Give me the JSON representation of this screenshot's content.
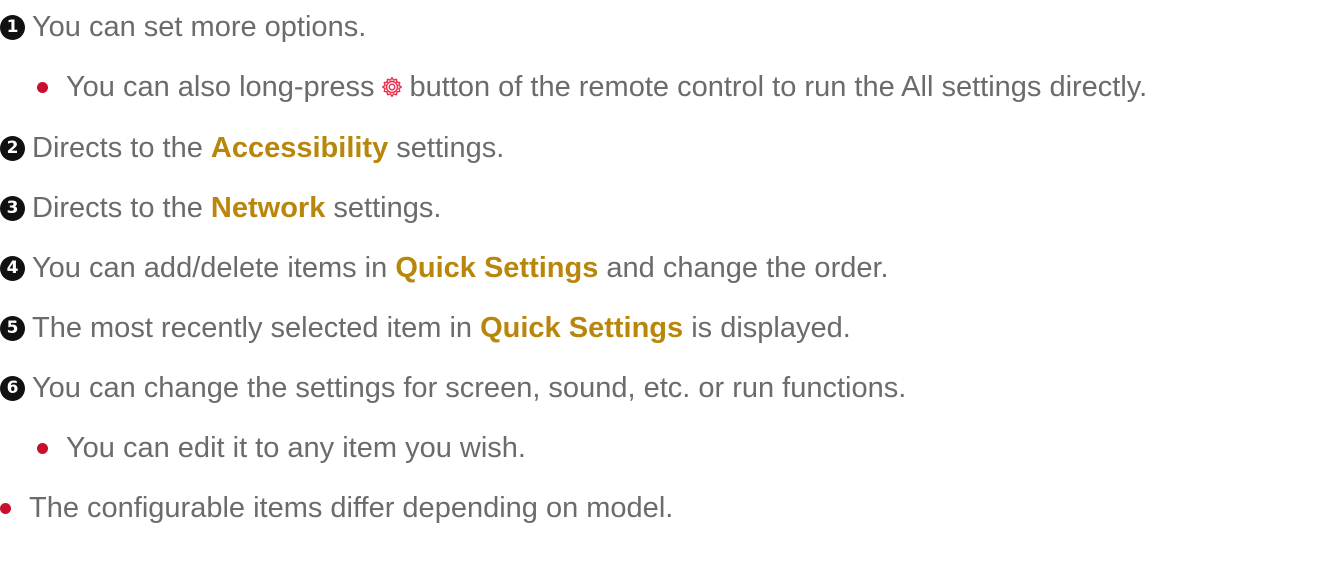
{
  "colors": {
    "text": "#6b6b6b",
    "highlight": "#b8860b",
    "bullet": "#c8102e",
    "number_badge": "#111111"
  },
  "items": [
    {
      "number": "1",
      "text": "You can set more options."
    },
    {
      "sub_bullet": {
        "before_icon": "You can also long-press",
        "icon": "settings-gear-icon",
        "after_icon": "button of the remote control to run the All settings directly."
      }
    },
    {
      "number": "2",
      "before": "Directs to the",
      "highlight": "Accessibility",
      "after": "settings."
    },
    {
      "number": "3",
      "before": "Directs to the",
      "highlight": "Network",
      "after": "settings."
    },
    {
      "number": "4",
      "before": "You can add/delete items in",
      "highlight": "Quick Settings",
      "after": "and change the order."
    },
    {
      "number": "5",
      "before": "The most recently selected item in",
      "highlight": "Quick Settings",
      "after": "is displayed."
    },
    {
      "number": "6",
      "text": "You can change the settings for screen, sound, etc. or run functions."
    },
    {
      "sub_bullet_text": "You can edit it to any item you wish."
    }
  ],
  "note": "The configurable items differ depending on model."
}
